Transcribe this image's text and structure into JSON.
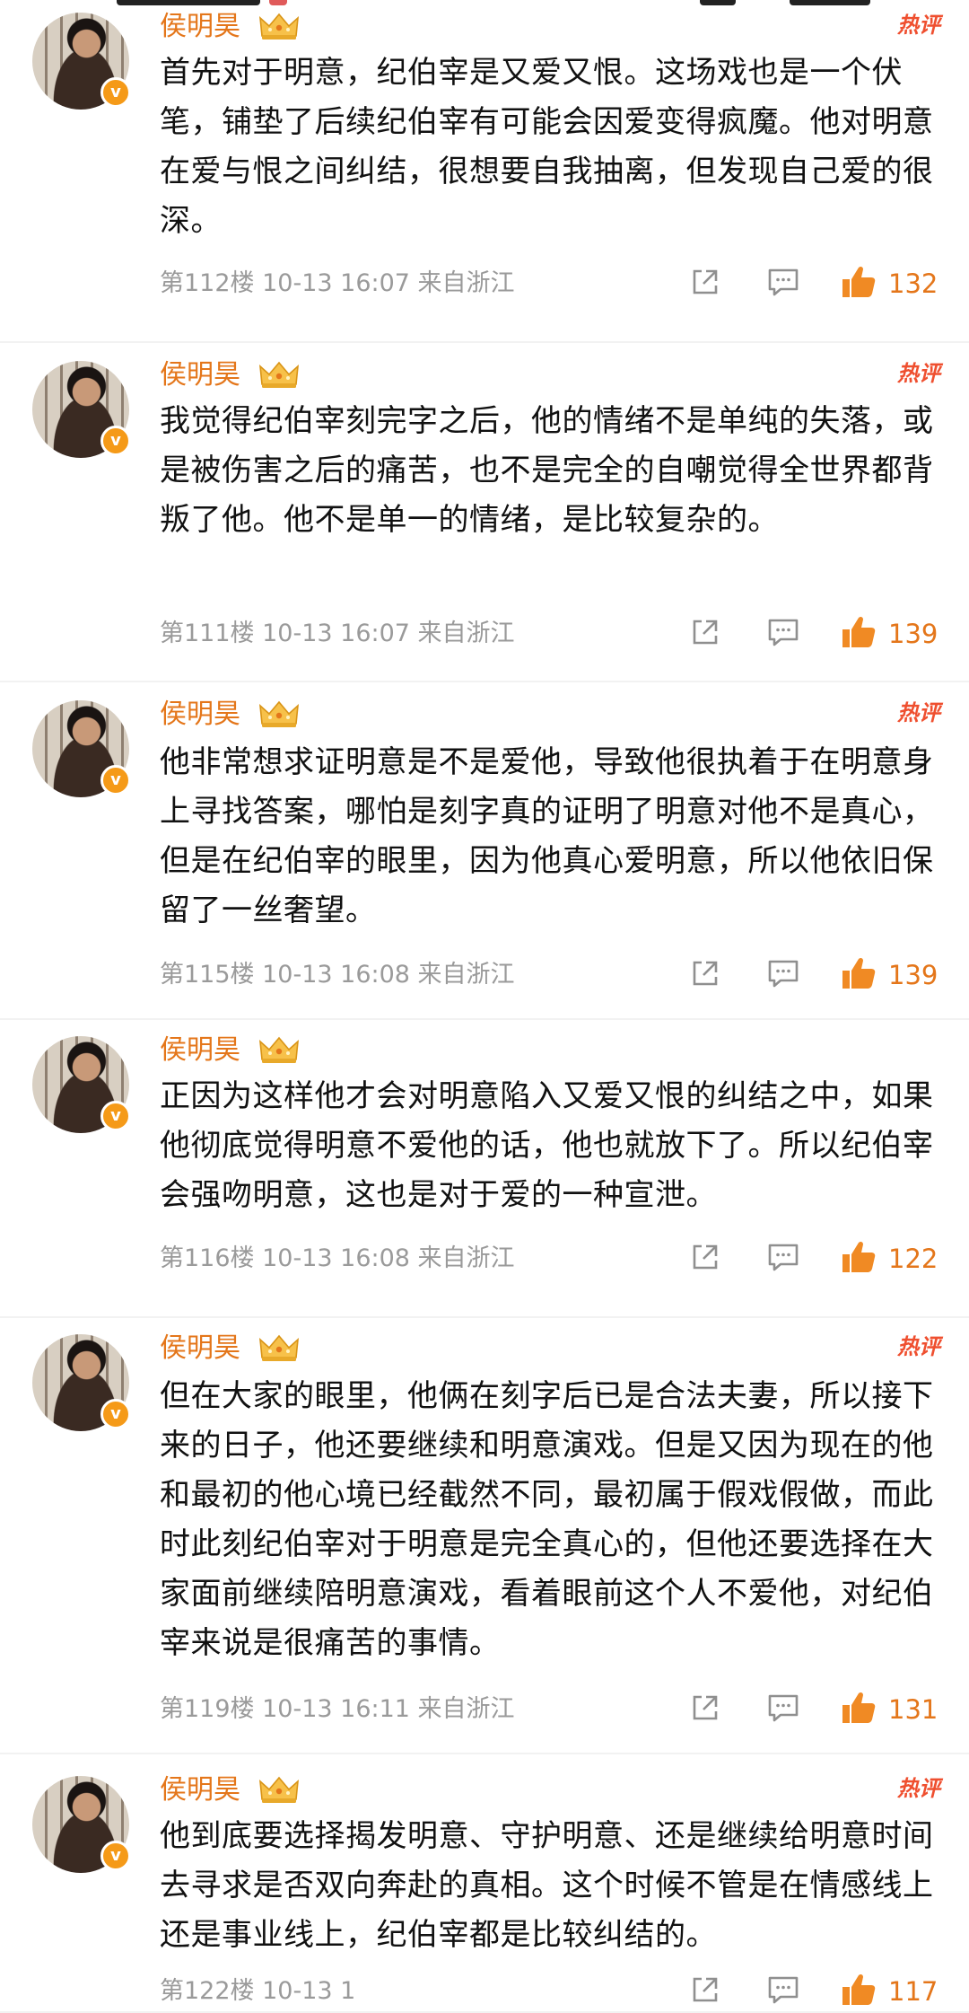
{
  "comments": [
    {
      "author": "侯明昊",
      "hot_label": "热评",
      "text": "首先对于明意，纪伯宰是又爱又恨。这场戏也是一个伏笔，铺垫了后续纪伯宰有可能会因爱变得疯魔。他对明意在爱与恨之间纠结，很想要自我抽离，但发现自己爱的很深。",
      "meta": "第112楼 10-13 16:07 来自浙江",
      "likes": "132"
    },
    {
      "author": "侯明昊",
      "hot_label": "热评",
      "text": "我觉得纪伯宰刻完字之后，他的情绪不是单纯的失落，或是被伤害之后的痛苦，也不是完全的自嘲觉得全世界都背叛了他。他不是单一的情绪，是比较复杂的。",
      "meta": "第111楼 10-13 16:07 来自浙江",
      "likes": "139"
    },
    {
      "author": "侯明昊",
      "hot_label": "热评",
      "text": "他非常想求证明意是不是爱他，导致他很执着于在明意身上寻找答案，哪怕是刻字真的证明了明意对他不是真心，但是在纪伯宰的眼里，因为他真心爱明意，所以他依旧保留了一丝奢望。",
      "meta": "第115楼 10-13 16:08 来自浙江",
      "likes": "139"
    },
    {
      "author": "侯明昊",
      "hot_label": "",
      "text": "正因为这样他才会对明意陷入又爱又恨的纠结之中，如果他彻底觉得明意不爱他的话，他也就放下了。所以纪伯宰会强吻明意，这也是对于爱的一种宣泄。",
      "meta": "第116楼 10-13 16:08 来自浙江",
      "likes": "122"
    },
    {
      "author": "侯明昊",
      "hot_label": "热评",
      "text": "但在大家的眼里，他俩在刻字后已是合法夫妻，所以接下来的日子，他还要继续和明意演戏。但是又因为现在的他和最初的他心境已经截然不同，最初属于假戏假做，而此时此刻纪伯宰对于明意是完全真心的，但他还要选择在大家面前继续陪明意演戏，看着眼前这个人不爱他，对纪伯宰来说是很痛苦的事情。",
      "meta": "第119楼 10-13 16:11 来自浙江",
      "likes": "131"
    },
    {
      "author": "侯明昊",
      "hot_label": "热评",
      "text": "他到底要选择揭发明意、守护明意、还是继续给明意时间去寻求是否双向奔赴的真相。这个时候不管是在情感线上还是事业线上，纪伯宰都是比较纠结的。",
      "meta": "第122楼 10-13 1",
      "likes": "117"
    }
  ],
  "icons": {
    "verified": "verified-badge-icon",
    "crown": "crown-icon",
    "share": "share-icon",
    "comment": "comment-icon",
    "like": "thumbs-up-icon"
  },
  "colors": {
    "author": "#e4761a",
    "hot": "#ef4f2f",
    "meta": "#9a9a9a",
    "like": "#f08a24"
  }
}
